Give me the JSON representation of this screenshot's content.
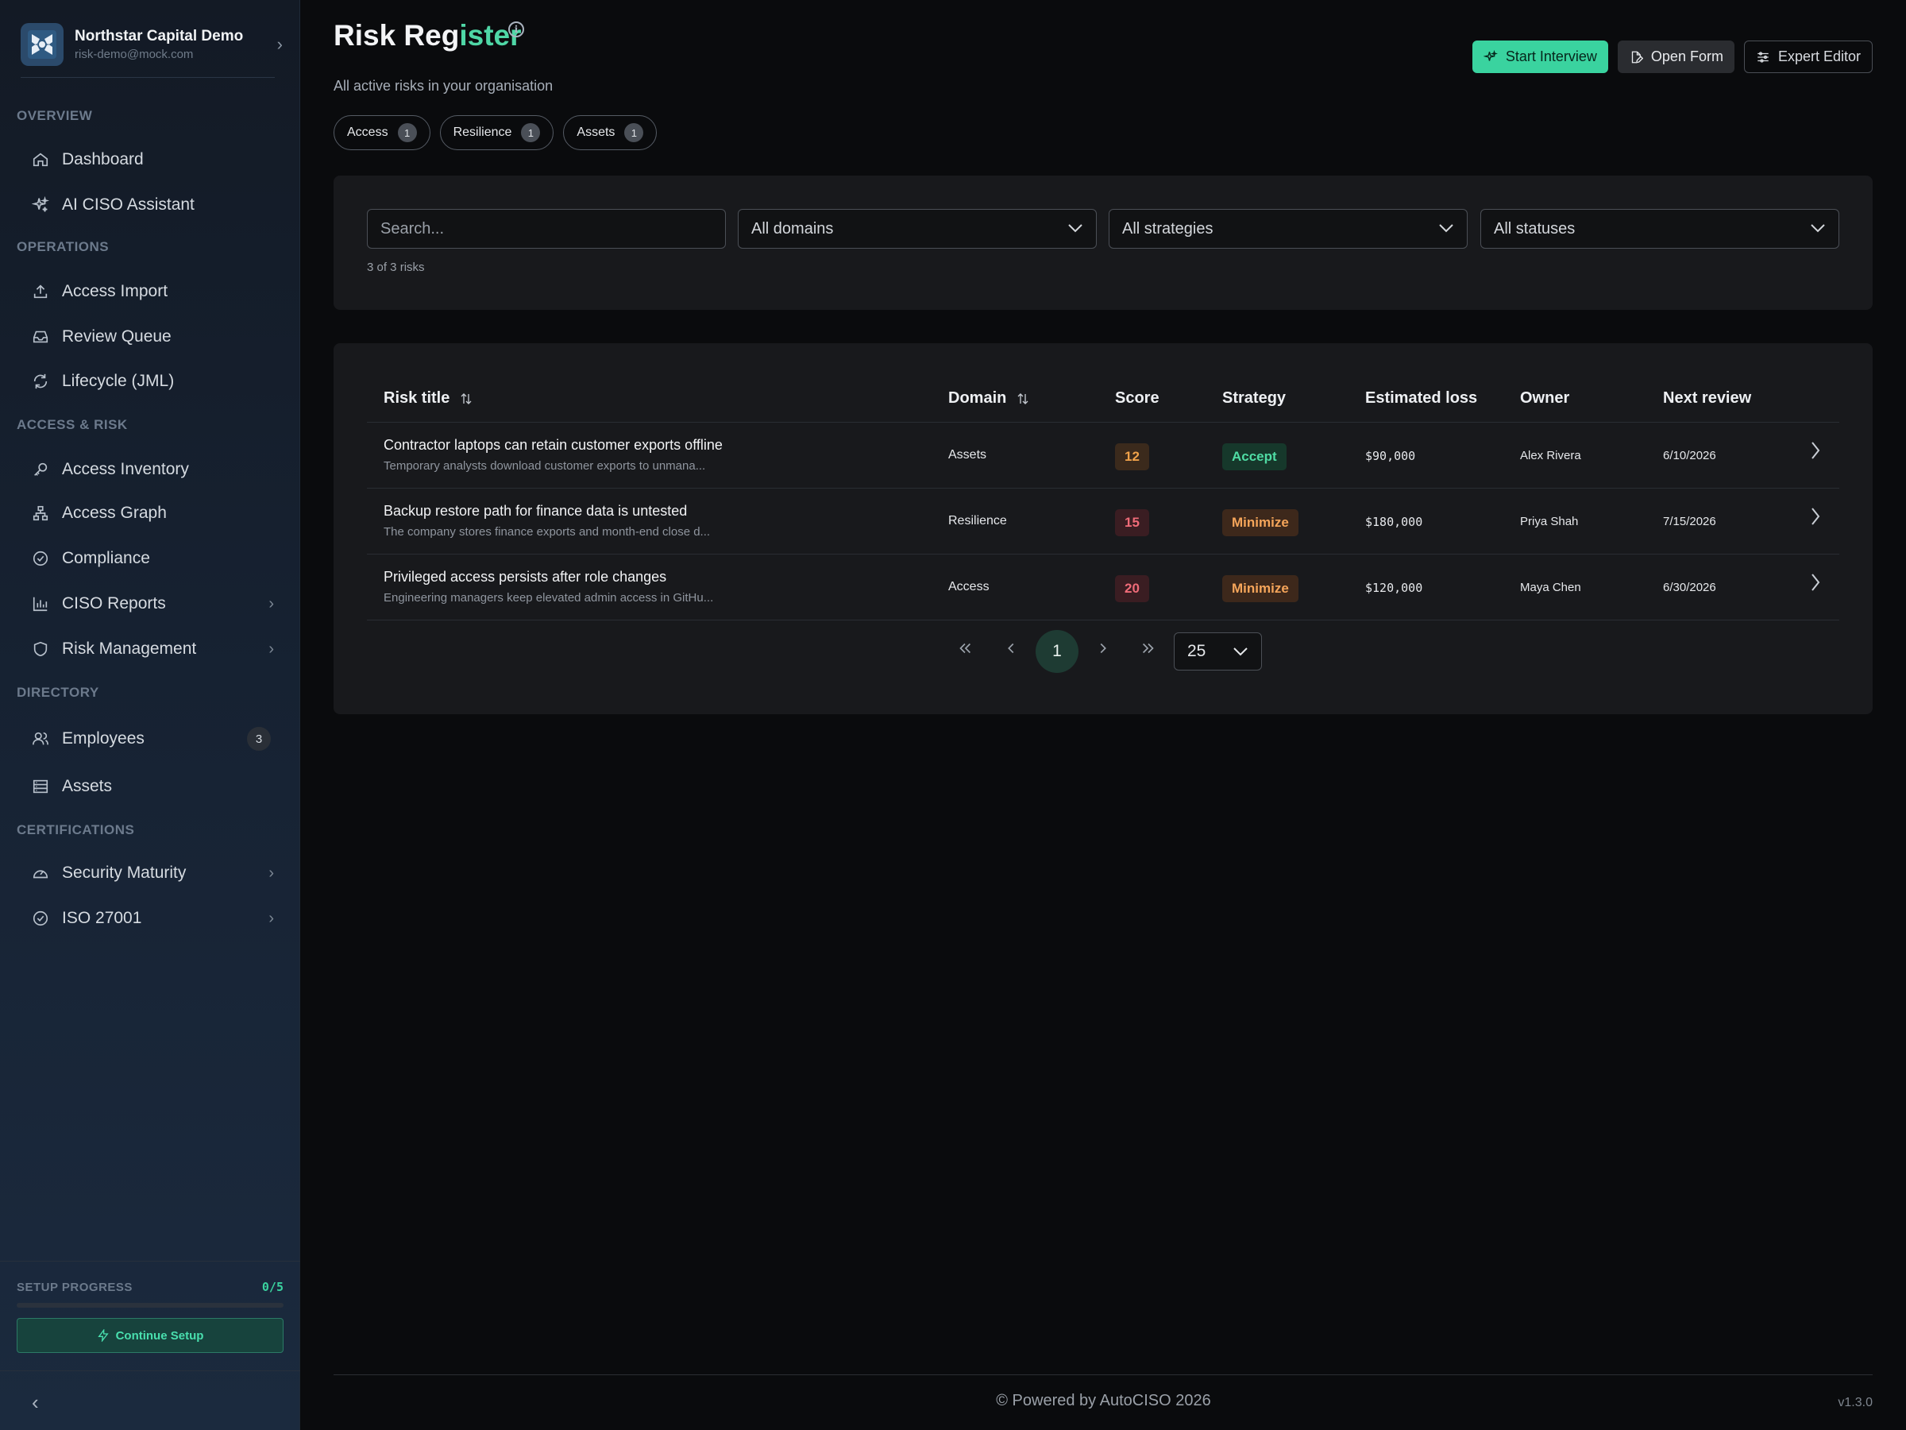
{
  "org": {
    "name": "Northstar Capital Demo",
    "email": "risk-demo@mock.com"
  },
  "sidebar": {
    "sections": {
      "overview": "OVERVIEW",
      "operations": "OPERATIONS",
      "access_risk": "ACCESS & RISK",
      "directory": "DIRECTORY",
      "certifications": "CERTIFICATIONS"
    },
    "items": {
      "dashboard": "Dashboard",
      "ai_ciso": "AI CISO Assistant",
      "access_import": "Access Import",
      "review_queue": "Review Queue",
      "lifecycle": "Lifecycle (JML)",
      "access_inventory": "Access Inventory",
      "access_graph": "Access Graph",
      "compliance": "Compliance",
      "ciso_reports": "CISO Reports",
      "risk_management": "Risk Management",
      "employees": "Employees",
      "employees_count": "3",
      "assets": "Assets",
      "security_maturity": "Security Maturity",
      "iso": "ISO 27001"
    },
    "setup": {
      "label": "SETUP PROGRESS",
      "count": "0/5",
      "progress": 0,
      "button": "Continue Setup"
    }
  },
  "header": {
    "title_part1": "Risk Reg",
    "title_part2": "ister",
    "info_glyph": "i",
    "subtitle": "All active risks in your organisation",
    "chips": [
      {
        "label": "Access",
        "count": "1"
      },
      {
        "label": "Resilience",
        "count": "1"
      },
      {
        "label": "Assets",
        "count": "1"
      }
    ],
    "actions": {
      "start_interview": "Start Interview",
      "open_form": "Open Form",
      "expert_editor": "Expert Editor"
    }
  },
  "filters": {
    "search_placeholder": "Search...",
    "domain": "All domains",
    "strategy": "All strategies",
    "status": "All statuses",
    "result_count": "3 of 3 risks"
  },
  "table": {
    "headers": {
      "title": "Risk title",
      "domain": "Domain",
      "score": "Score",
      "strategy": "Strategy",
      "loss": "Estimated loss",
      "owner": "Owner",
      "review": "Next review"
    },
    "rows": [
      {
        "title": "Contractor laptops can retain customer exports offline",
        "desc": "Temporary analysts download customer exports to unmana...",
        "domain": "Assets",
        "score": "12",
        "strategy": "Accept",
        "loss": "$90,000",
        "owner": "Alex Rivera",
        "review": "6/10/2026"
      },
      {
        "title": "Backup restore path for finance data is untested",
        "desc": "The company stores finance exports and month-end close d...",
        "domain": "Resilience",
        "score": "15",
        "strategy": "Minimize",
        "loss": "$180,000",
        "owner": "Priya Shah",
        "review": "7/15/2026"
      },
      {
        "title": "Privileged access persists after role changes",
        "desc": "Engineering managers keep elevated admin access in GitHu...",
        "domain": "Access",
        "score": "20",
        "strategy": "Minimize",
        "loss": "$120,000",
        "owner": "Maya Chen",
        "review": "6/30/2026"
      }
    ],
    "pagination": {
      "current_page": "1",
      "page_size": "25"
    }
  },
  "colors": {
    "accent": "#3ad39f",
    "score_orange": "#f0a24a",
    "score_red": "#ef6b78",
    "accept_green": "#4fdca4",
    "minimize_orange": "#f5a55a"
  },
  "footer": {
    "text": "© Powered by AutoCISO 2026",
    "version": "v1.3.0"
  }
}
